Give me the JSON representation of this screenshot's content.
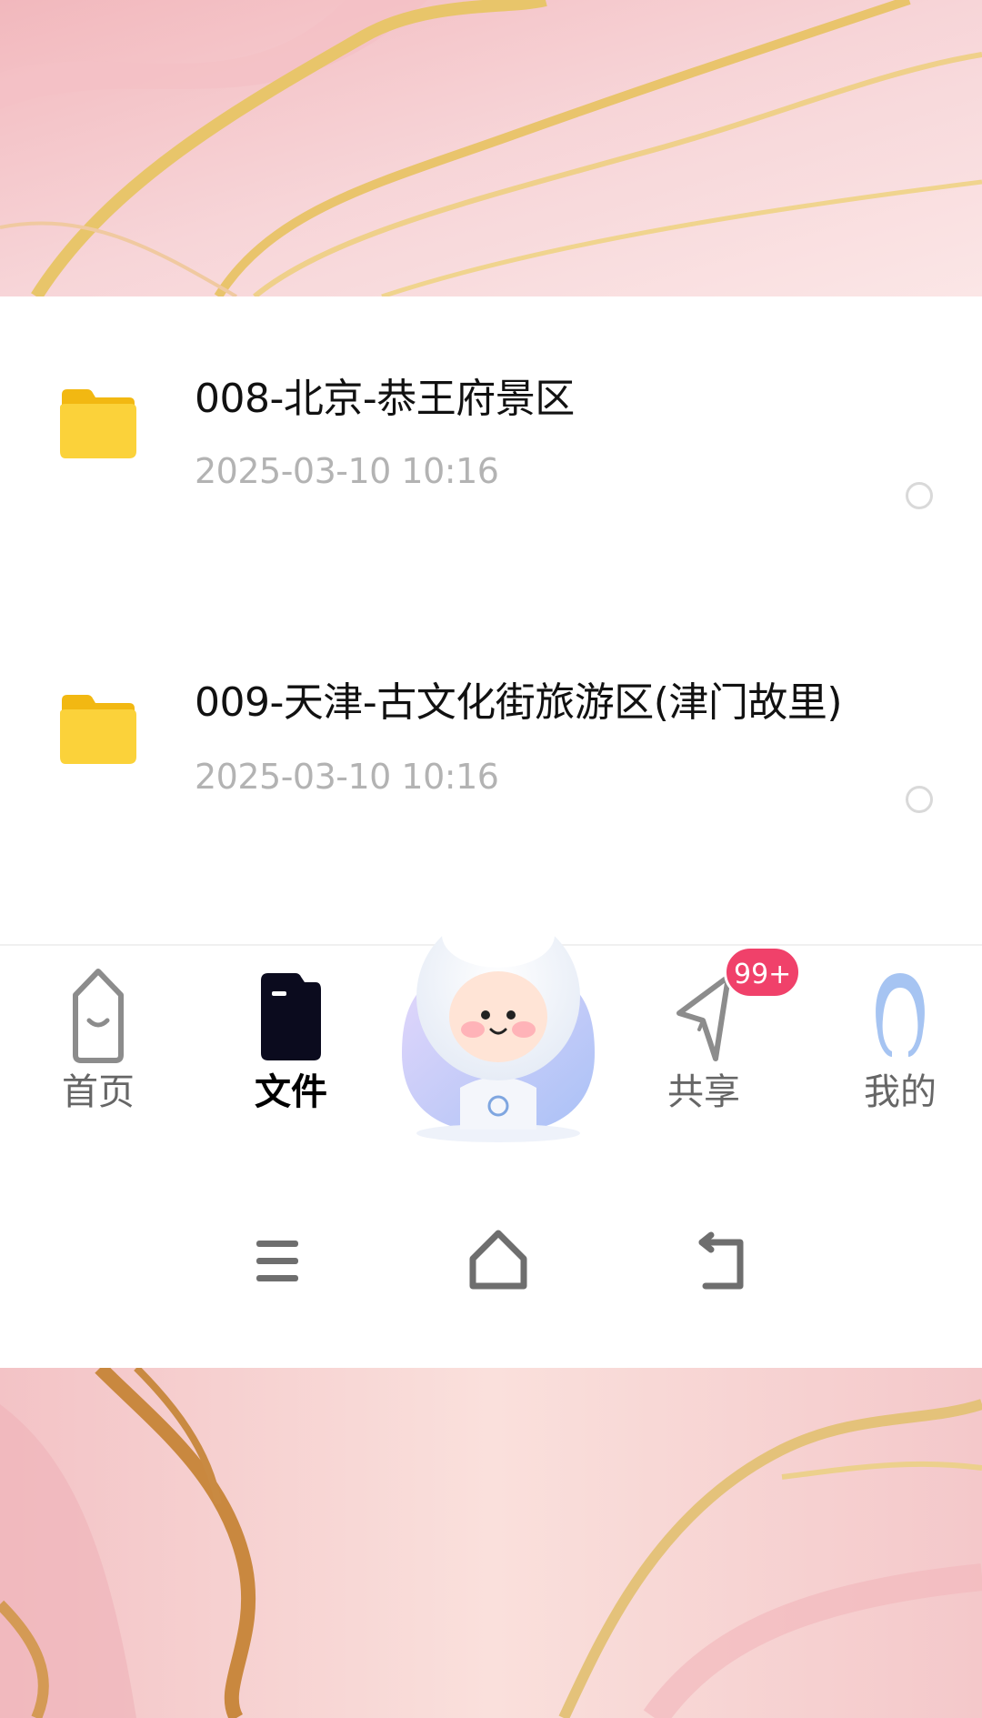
{
  "files": [
    {
      "name": "008-北京-恭王府景区",
      "date": "2025-03-10  10:16",
      "icon": "folder-icon"
    },
    {
      "name": "009-天津-古文化街旅游区(津门故里)",
      "date": "2025-03-10  10:16",
      "icon": "folder-icon"
    }
  ],
  "tabs": [
    {
      "label": "首页",
      "icon": "home-icon",
      "active": false
    },
    {
      "label": "文件",
      "icon": "file-icon",
      "active": true
    },
    {
      "label": "",
      "icon": "assistant-mascot-icon",
      "active": false
    },
    {
      "label": "共享",
      "icon": "share-send-icon",
      "active": false,
      "badge": "99+"
    },
    {
      "label": "我的",
      "icon": "profile-icon",
      "active": false
    }
  ],
  "system_nav": [
    "menu-icon",
    "home-outline-icon",
    "back-icon"
  ],
  "colors": {
    "folder": "#f8c91e",
    "badge": "#f0416a",
    "active_tab": "#000000",
    "inactive_tab": "#666666",
    "date_text": "#b3b3b3"
  }
}
